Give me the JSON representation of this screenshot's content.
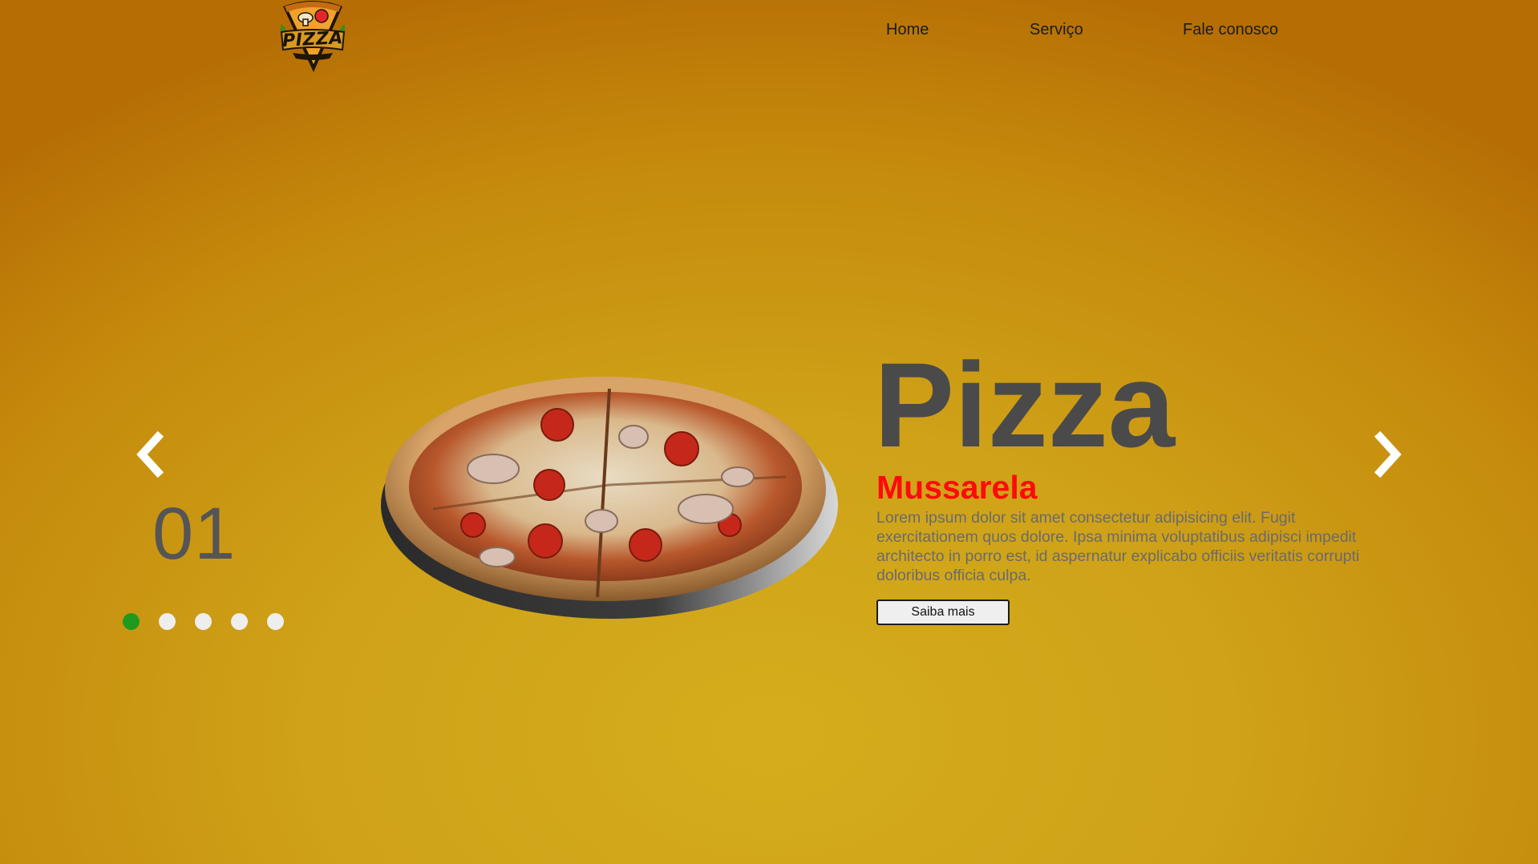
{
  "header": {
    "logo_text": "PIZZA",
    "nav": {
      "home": "Home",
      "servico": "Serviço",
      "fale_conosco": "Fale conosco"
    }
  },
  "slider": {
    "current_index": "01",
    "dots_total": 5,
    "active_dot": 1,
    "prev_icon": "chevron-left-icon",
    "next_icon": "chevron-right-icon"
  },
  "hero": {
    "title": "Pizza",
    "subtitle": "Mussarela",
    "description": "Lorem ipsum dolor sit amet consectetur adipisicing elit. Fugit exercitationem quos dolore. Ipsa minima voluptatibus adipisci impedit architecto in porro est, id aspernatur explicabo officiis veritatis corrupti doloribus officia culpa.",
    "button_label": "Saiba mais"
  },
  "colors": {
    "background": "#cfa218",
    "title": "#4a4a4a",
    "subtitle": "#ff0a0a",
    "active_dot": "#1f9a1f",
    "inactive_dot": "#eeeeee"
  }
}
